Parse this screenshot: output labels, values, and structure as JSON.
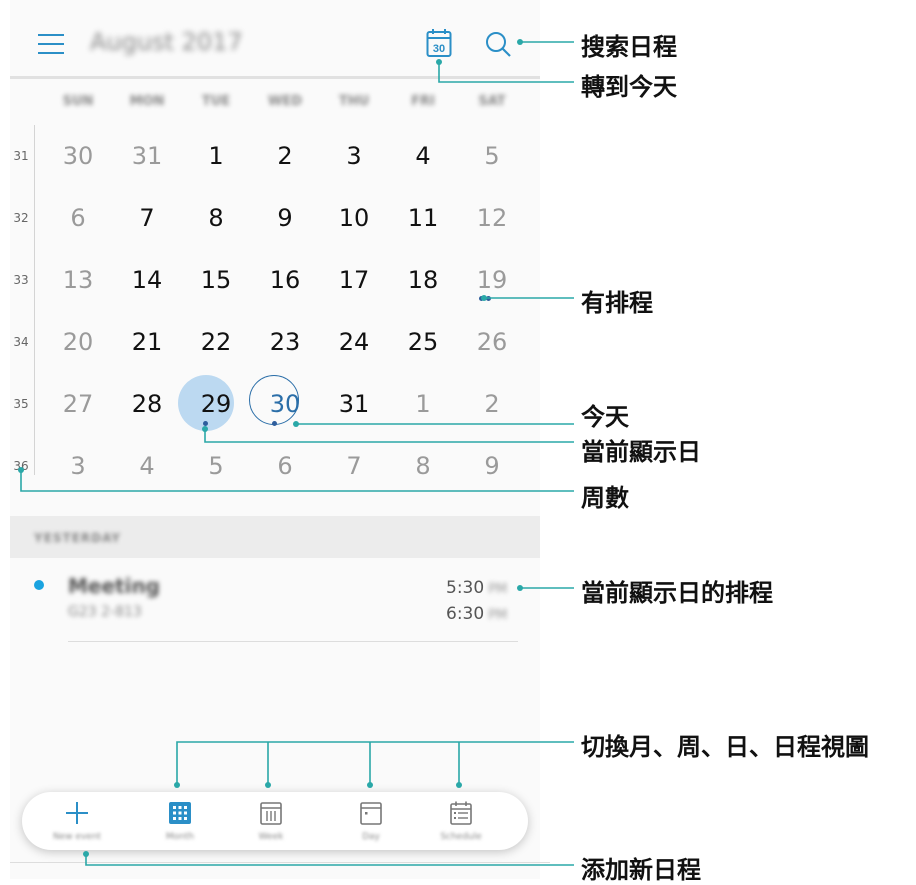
{
  "header": {
    "month_title": "August 2017",
    "today_icon_number": "30"
  },
  "weekdays": [
    "SUN",
    "MON",
    "TUE",
    "WED",
    "THU",
    "FRI",
    "SAT"
  ],
  "weeks": [
    {
      "num": "31",
      "days": [
        "30",
        "31",
        "1",
        "2",
        "3",
        "4",
        "5"
      ]
    },
    {
      "num": "32",
      "days": [
        "6",
        "7",
        "8",
        "9",
        "10",
        "11",
        "12"
      ]
    },
    {
      "num": "33",
      "days": [
        "13",
        "14",
        "15",
        "16",
        "17",
        "18",
        "19"
      ]
    },
    {
      "num": "34",
      "days": [
        "20",
        "21",
        "22",
        "23",
        "24",
        "25",
        "26"
      ]
    },
    {
      "num": "35",
      "days": [
        "27",
        "28",
        "29",
        "30",
        "31",
        "1",
        "2"
      ]
    },
    {
      "num": "36",
      "days": [
        "3",
        "4",
        "5",
        "6",
        "7",
        "8",
        "9"
      ]
    }
  ],
  "agenda": {
    "section_label": "YESTERDAY",
    "event": {
      "title": "Meeting",
      "location": "G23 2-813",
      "start": "5:30",
      "end": "6:30",
      "ampm": "PM"
    }
  },
  "bottom_nav": {
    "new_event": "New event",
    "month": "Month",
    "week": "Week",
    "day": "Day",
    "schedule": "Schedule"
  },
  "annotations": {
    "search": "搜索日程",
    "goto_today": "轉到今天",
    "has_schedule": "有排程",
    "today": "今天",
    "current_day": "當前顯示日",
    "week_number": "周數",
    "current_day_schedule": "當前顯示日的排程",
    "switch_views": "切換月、周、日、日程視圖",
    "add_schedule": "添加新日程"
  },
  "colors": {
    "accent": "#2b8fc7",
    "selected": "#bcd9f1",
    "callout_line": "#2aa8a8",
    "event_dot": "#1aa3e0"
  }
}
